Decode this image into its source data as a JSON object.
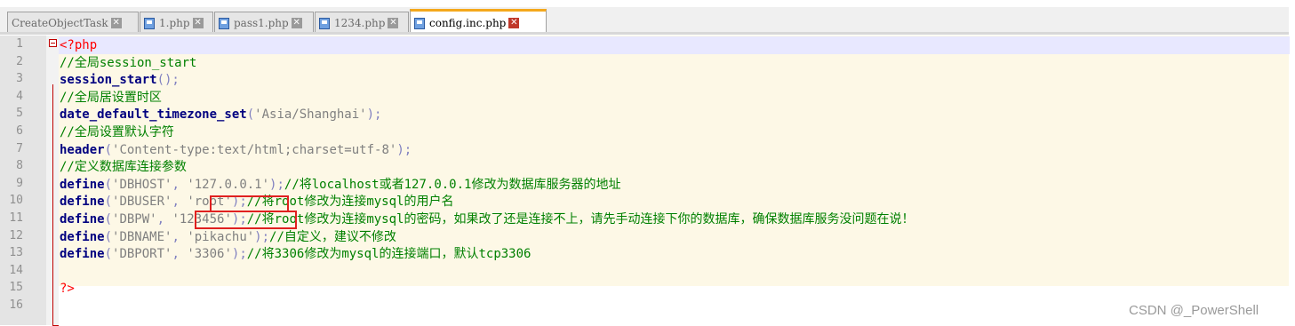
{
  "tabs": [
    {
      "label": "CreateObjectTask",
      "active": false
    },
    {
      "label": "1.php",
      "active": false
    },
    {
      "label": "pass1.php",
      "active": false
    },
    {
      "label": "1234.php",
      "active": false
    },
    {
      "label": "config.inc.php",
      "active": true
    }
  ],
  "editor": {
    "line_numbers": [
      "1",
      "2",
      "3",
      "4",
      "5",
      "6",
      "7",
      "8",
      "9",
      "10",
      "11",
      "12",
      "13",
      "14",
      "15",
      "16"
    ],
    "lines": [
      [
        {
          "t": "<?php",
          "c": "ph"
        }
      ],
      [
        {
          "t": "//全局session_start",
          "c": "cm"
        }
      ],
      [
        {
          "t": "session_start",
          "c": "kw"
        },
        {
          "t": "();",
          "c": "op"
        }
      ],
      [
        {
          "t": "//全局居设置时区",
          "c": "cm"
        }
      ],
      [
        {
          "t": "date_default_timezone_set",
          "c": "kw"
        },
        {
          "t": "(",
          "c": "op"
        },
        {
          "t": "'Asia/Shanghai'",
          "c": "st"
        },
        {
          "t": ");",
          "c": "op"
        }
      ],
      [
        {
          "t": "//全局设置默认字符",
          "c": "cm"
        }
      ],
      [
        {
          "t": "header",
          "c": "kw"
        },
        {
          "t": "(",
          "c": "op"
        },
        {
          "t": "'Content-type:text/html;charset=utf-8'",
          "c": "st"
        },
        {
          "t": ");",
          "c": "op"
        }
      ],
      [
        {
          "t": "//定义数据库连接参数",
          "c": "cm"
        }
      ],
      [
        {
          "t": "define",
          "c": "kw"
        },
        {
          "t": "(",
          "c": "op"
        },
        {
          "t": "'DBHOST'",
          "c": "st"
        },
        {
          "t": ", ",
          "c": "op"
        },
        {
          "t": "'127.0.0.1'",
          "c": "st"
        },
        {
          "t": ");",
          "c": "op"
        },
        {
          "t": "//将localhost或者127.0.0.1修改为数据库服务器的地址",
          "c": "cm"
        }
      ],
      [
        {
          "t": "define",
          "c": "kw"
        },
        {
          "t": "(",
          "c": "op"
        },
        {
          "t": "'DBUSER'",
          "c": "st"
        },
        {
          "t": ", ",
          "c": "op"
        },
        {
          "t": "'root'",
          "c": "st"
        },
        {
          "t": ");",
          "c": "op"
        },
        {
          "t": "//将root修改为连接mysql的用户名",
          "c": "cm"
        }
      ],
      [
        {
          "t": "define",
          "c": "kw"
        },
        {
          "t": "(",
          "c": "op"
        },
        {
          "t": "'DBPW'",
          "c": "st"
        },
        {
          "t": ", ",
          "c": "op"
        },
        {
          "t": "'123456'",
          "c": "st"
        },
        {
          "t": ");",
          "c": "op"
        },
        {
          "t": "//将root修改为连接mysql的密码，如果改了还是连接不上，请先手动连接下你的数据库，确保数据库服务没问题在说！",
          "c": "cm"
        }
      ],
      [
        {
          "t": "define",
          "c": "kw"
        },
        {
          "t": "(",
          "c": "op"
        },
        {
          "t": "'DBNAME'",
          "c": "st"
        },
        {
          "t": ", ",
          "c": "op"
        },
        {
          "t": "'pikachu'",
          "c": "st"
        },
        {
          "t": ");",
          "c": "op"
        },
        {
          "t": "//自定义，建议不修改",
          "c": "cm"
        }
      ],
      [
        {
          "t": "define",
          "c": "kw"
        },
        {
          "t": "(",
          "c": "op"
        },
        {
          "t": "'DBPORT'",
          "c": "st"
        },
        {
          "t": ", ",
          "c": "op"
        },
        {
          "t": "'3306'",
          "c": "st"
        },
        {
          "t": ");",
          "c": "op"
        },
        {
          "t": "//将3306修改为mysql的连接端口，默认tcp3306",
          "c": "cm"
        }
      ],
      [],
      [
        {
          "t": "?>",
          "c": "ph"
        }
      ],
      []
    ]
  },
  "watermark": "CSDN @_PowerShell"
}
